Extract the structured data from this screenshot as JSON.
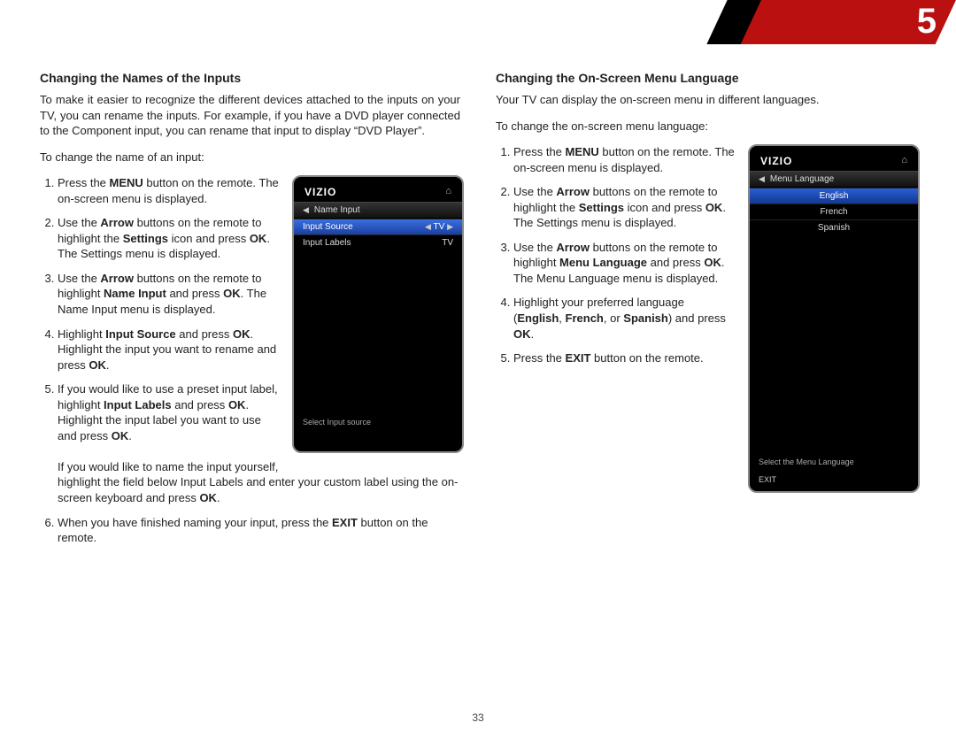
{
  "header": {
    "chapter": "5"
  },
  "footer": {
    "page": "33"
  },
  "common": {
    "menu": "MENU",
    "arrow": "Arrow",
    "settings": "Settings",
    "ok": "OK",
    "exit": "EXIT"
  },
  "left": {
    "heading": "Changing the Names of the Inputs",
    "intro": "To make it easier to recognize the different devices attached to the inputs on your TV, you can rename the inputs. For example, if you have a DVD player connected to the Component input, you can rename that input to display “DVD Player”.",
    "lead": "To change the name of an input:",
    "tv": {
      "logo": "VIZIO",
      "title": "Name Input",
      "rows": [
        {
          "label": "Input Source",
          "value": "TV"
        },
        {
          "label": "Input Labels",
          "value": "TV"
        }
      ],
      "hint": "Select Input source"
    }
  },
  "right": {
    "heading": "Changing the On-Screen Menu Language",
    "intro": "Your TV can display the on-screen menu in different languages.",
    "lead": "To change the on-screen menu language:",
    "tv": {
      "logo": "VIZIO",
      "title": "Menu Language",
      "options": [
        "English",
        "French",
        "Spanish"
      ],
      "hint": "Select the Menu Language",
      "exit": "EXIT"
    }
  }
}
